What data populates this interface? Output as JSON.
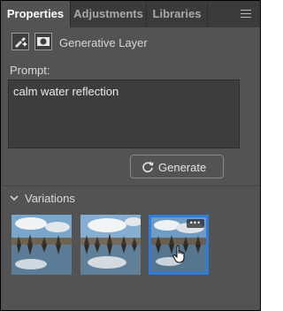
{
  "tabs": [
    {
      "label": "Properties",
      "active": true
    },
    {
      "label": "Adjustments",
      "active": false
    },
    {
      "label": "Libraries",
      "active": false
    }
  ],
  "layer": {
    "type_label": "Generative Layer",
    "icons": [
      "generative-brush-icon",
      "mask-icon"
    ]
  },
  "prompt": {
    "label": "Prompt:",
    "value": "calm water reflection"
  },
  "generate_button": {
    "label": "Generate",
    "icon": "generate-refresh-icon"
  },
  "variations": {
    "label": "Variations",
    "expanded": true,
    "items": [
      {
        "index": 1,
        "selected": false
      },
      {
        "index": 2,
        "selected": false
      },
      {
        "index": 3,
        "selected": true,
        "more_label": "•••"
      }
    ]
  },
  "colors": {
    "panel_bg": "#535353",
    "tab_bar_bg": "#3b3b3b",
    "selection_accent": "#2d7de0",
    "text": "#d8d8d8"
  }
}
